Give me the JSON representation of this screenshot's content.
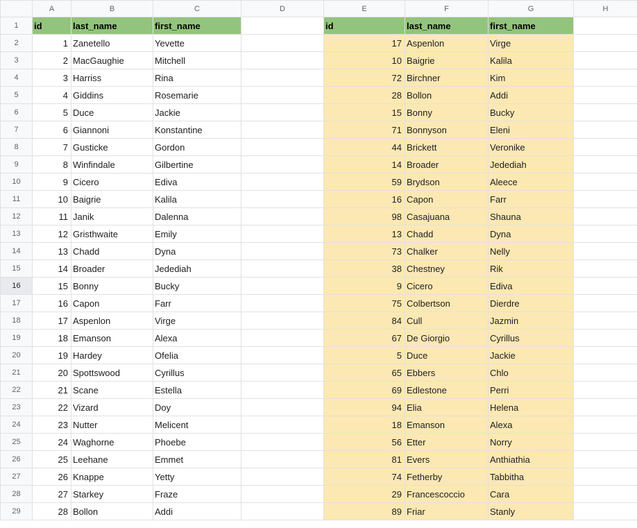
{
  "columns": [
    "A",
    "B",
    "C",
    "D",
    "E",
    "F",
    "G",
    "H"
  ],
  "selected_row_header": 16,
  "table_left": {
    "headers": {
      "id": "id",
      "last_name": "last_name",
      "first_name": "first_name"
    },
    "rows": [
      {
        "id": 1,
        "last_name": "Zanetello",
        "first_name": "Yevette"
      },
      {
        "id": 2,
        "last_name": "MacGaughie",
        "first_name": "Mitchell"
      },
      {
        "id": 3,
        "last_name": "Harriss",
        "first_name": "Rina"
      },
      {
        "id": 4,
        "last_name": "Giddins",
        "first_name": "Rosemarie"
      },
      {
        "id": 5,
        "last_name": "Duce",
        "first_name": "Jackie"
      },
      {
        "id": 6,
        "last_name": "Giannoni",
        "first_name": "Konstantine"
      },
      {
        "id": 7,
        "last_name": "Gusticke",
        "first_name": "Gordon"
      },
      {
        "id": 8,
        "last_name": "Winfindale",
        "first_name": "Gilbertine"
      },
      {
        "id": 9,
        "last_name": "Cicero",
        "first_name": "Ediva"
      },
      {
        "id": 10,
        "last_name": "Baigrie",
        "first_name": "Kalila"
      },
      {
        "id": 11,
        "last_name": "Janik",
        "first_name": "Dalenna"
      },
      {
        "id": 12,
        "last_name": "Gristhwaite",
        "first_name": "Emily"
      },
      {
        "id": 13,
        "last_name": "Chadd",
        "first_name": "Dyna"
      },
      {
        "id": 14,
        "last_name": "Broader",
        "first_name": "Jedediah"
      },
      {
        "id": 15,
        "last_name": "Bonny",
        "first_name": "Bucky"
      },
      {
        "id": 16,
        "last_name": "Capon",
        "first_name": "Farr"
      },
      {
        "id": 17,
        "last_name": "Aspenlon",
        "first_name": "Virge"
      },
      {
        "id": 18,
        "last_name": "Emanson",
        "first_name": "Alexa"
      },
      {
        "id": 19,
        "last_name": "Hardey",
        "first_name": "Ofelia"
      },
      {
        "id": 20,
        "last_name": "Spottswood",
        "first_name": "Cyrillus"
      },
      {
        "id": 21,
        "last_name": "Scane",
        "first_name": "Estella"
      },
      {
        "id": 22,
        "last_name": "Vizard",
        "first_name": "Doy"
      },
      {
        "id": 23,
        "last_name": "Nutter",
        "first_name": "Melicent"
      },
      {
        "id": 24,
        "last_name": "Waghorne",
        "first_name": "Phoebe"
      },
      {
        "id": 25,
        "last_name": "Leehane",
        "first_name": "Emmet"
      },
      {
        "id": 26,
        "last_name": "Knappe",
        "first_name": "Yetty"
      },
      {
        "id": 27,
        "last_name": "Starkey",
        "first_name": "Fraze"
      },
      {
        "id": 28,
        "last_name": "Bollon",
        "first_name": "Addi"
      }
    ]
  },
  "table_right": {
    "headers": {
      "id": "id",
      "last_name": "last_name",
      "first_name": "first_name"
    },
    "rows": [
      {
        "id": 17,
        "last_name": "Aspenlon",
        "first_name": "Virge"
      },
      {
        "id": 10,
        "last_name": "Baigrie",
        "first_name": "Kalila"
      },
      {
        "id": 72,
        "last_name": "Birchner",
        "first_name": "Kim"
      },
      {
        "id": 28,
        "last_name": "Bollon",
        "first_name": "Addi"
      },
      {
        "id": 15,
        "last_name": "Bonny",
        "first_name": "Bucky"
      },
      {
        "id": 71,
        "last_name": "Bonnyson",
        "first_name": "Eleni"
      },
      {
        "id": 44,
        "last_name": "Brickett",
        "first_name": "Veronike"
      },
      {
        "id": 14,
        "last_name": "Broader",
        "first_name": "Jedediah"
      },
      {
        "id": 59,
        "last_name": "Brydson",
        "first_name": "Aleece"
      },
      {
        "id": 16,
        "last_name": "Capon",
        "first_name": "Farr"
      },
      {
        "id": 98,
        "last_name": "Casajuana",
        "first_name": "Shauna"
      },
      {
        "id": 13,
        "last_name": "Chadd",
        "first_name": "Dyna"
      },
      {
        "id": 73,
        "last_name": "Chalker",
        "first_name": "Nelly"
      },
      {
        "id": 38,
        "last_name": "Chestney",
        "first_name": "Rik"
      },
      {
        "id": 9,
        "last_name": "Cicero",
        "first_name": "Ediva"
      },
      {
        "id": 75,
        "last_name": "Colbertson",
        "first_name": "Dierdre"
      },
      {
        "id": 84,
        "last_name": "Cull",
        "first_name": "Jazmin"
      },
      {
        "id": 67,
        "last_name": "De Giorgio",
        "first_name": "Cyrillus"
      },
      {
        "id": 5,
        "last_name": "Duce",
        "first_name": "Jackie"
      },
      {
        "id": 65,
        "last_name": "Ebbers",
        "first_name": "Chlo"
      },
      {
        "id": 69,
        "last_name": "Edlestone",
        "first_name": "Perri"
      },
      {
        "id": 94,
        "last_name": "Elia",
        "first_name": "Helena"
      },
      {
        "id": 18,
        "last_name": "Emanson",
        "first_name": "Alexa"
      },
      {
        "id": 56,
        "last_name": "Etter",
        "first_name": "Norry"
      },
      {
        "id": 81,
        "last_name": "Evers",
        "first_name": "Anthiathia"
      },
      {
        "id": 74,
        "last_name": "Fetherby",
        "first_name": "Tabbitha"
      },
      {
        "id": 29,
        "last_name": "Francescoccio",
        "first_name": "Cara"
      },
      {
        "id": 89,
        "last_name": "Friar",
        "first_name": "Stanly"
      }
    ]
  }
}
